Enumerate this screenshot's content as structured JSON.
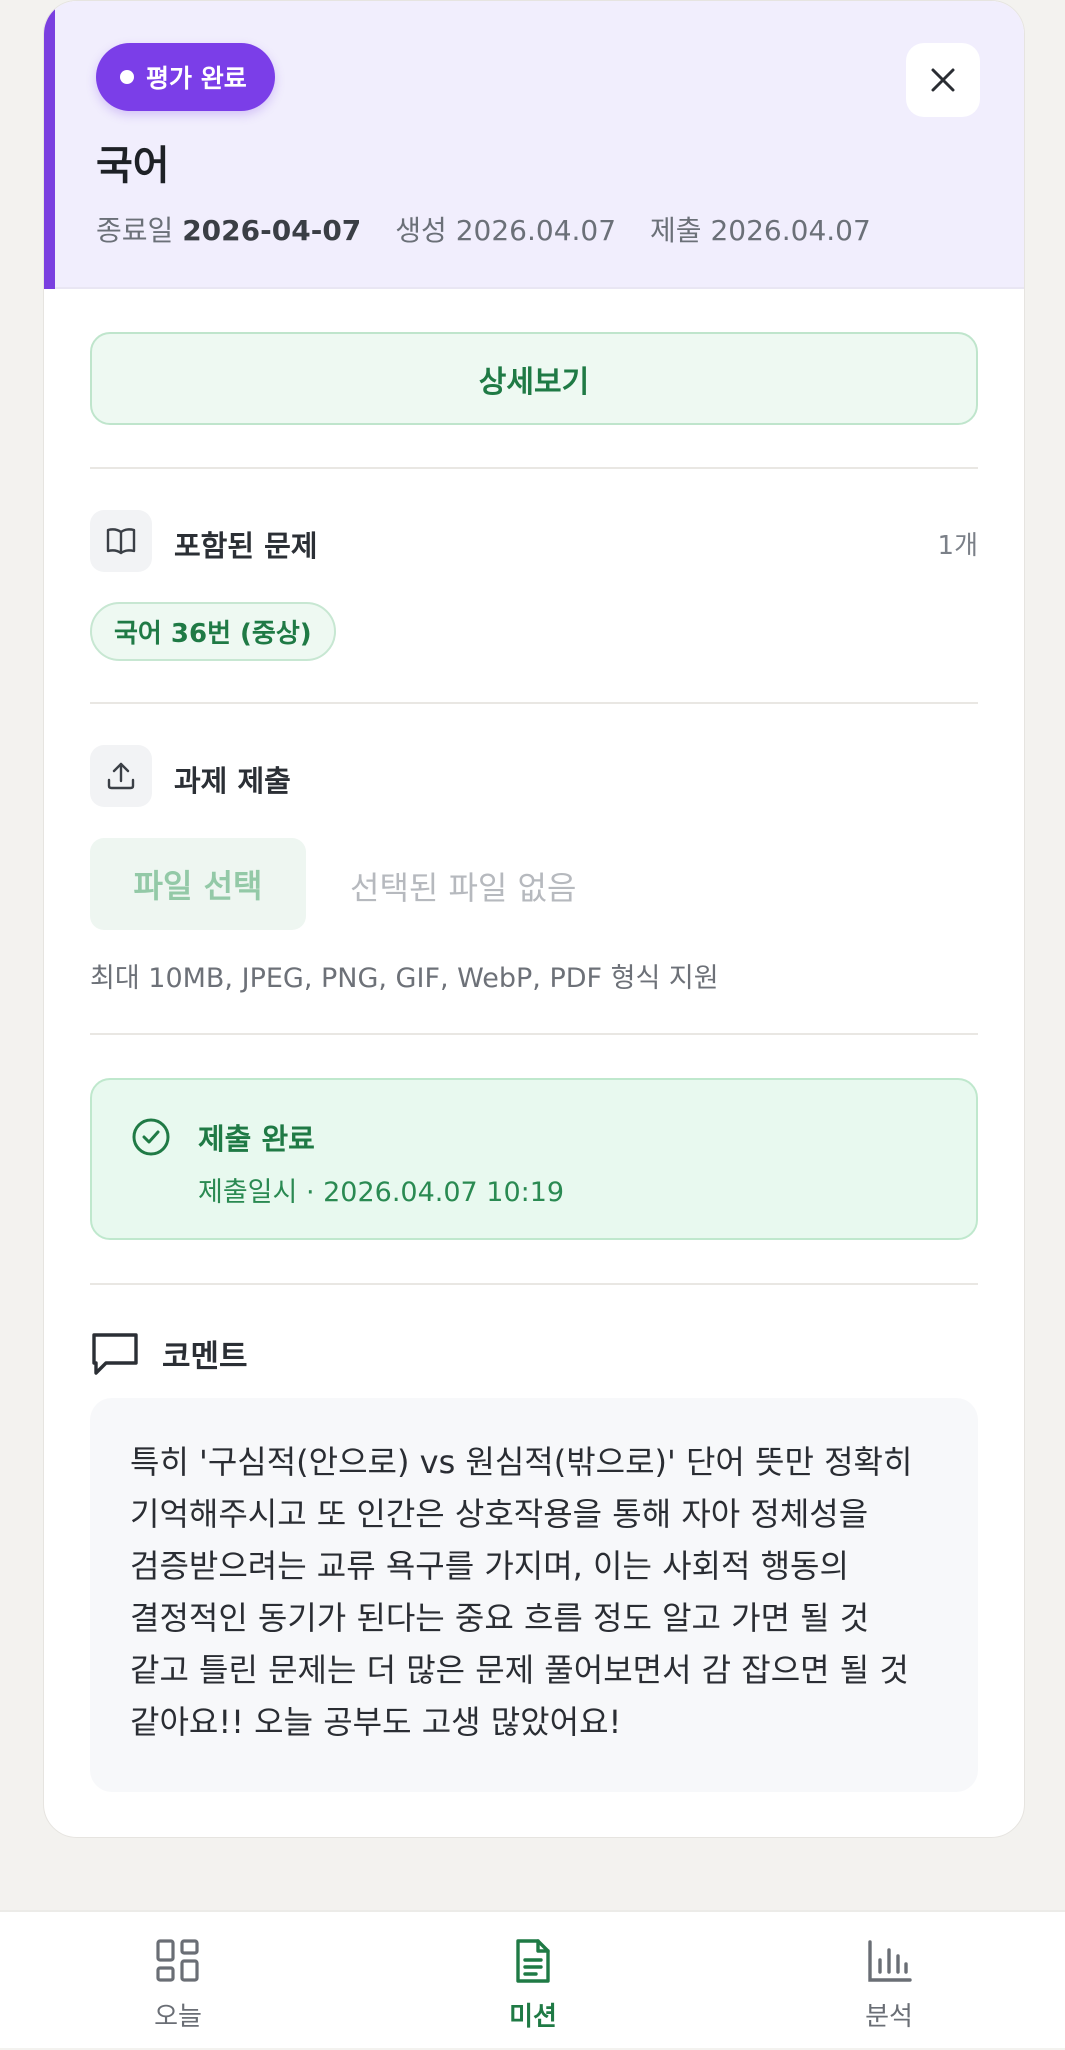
{
  "header": {
    "status_badge": "평가 완료",
    "subject": "국어",
    "due_label": "종료일",
    "due_date": "2026-04-07",
    "created": "생성 2026.04.07",
    "submitted": "제출 2026.04.07",
    "accent_color": "#7b3ee8"
  },
  "detail_button": "상세보기",
  "problems": {
    "title": "포함된 문제",
    "count": "1개",
    "items": [
      "국어 36번 (중상)"
    ],
    "icon": "book-icon"
  },
  "upload": {
    "title": "과제 제출",
    "file_button": "파일 선택",
    "file_status": "선택된 파일 없음",
    "hint": "최대 10MB, JPEG, PNG, GIF, WebP, PDF 형식 지원",
    "icon": "upload-icon"
  },
  "submission": {
    "title": "제출 완료",
    "time": "제출일시 · 2026.04.07 10:19",
    "icon": "check-circle-icon",
    "color": "#1f7a45"
  },
  "comment": {
    "title": "코멘트",
    "text": "특히 '구심적(안으로) vs 원심적(밖으로)' 단어 뜻만 정확히 기억해주시고 또 인간은 상호작용을 통해 자아 정체성을 검증받으려는 교류 욕구를 가지며, 이는 사회적 행동의 결정적인 동기가 된다는 중요 흐름 정도 알고 가면 될 것 같고 틀린 문제는 더 많은 문제 풀어보면서 감 잡으면 될 것 같아요!! 오늘 공부도 고생 많았어요!",
    "icon": "chat-bubble-icon"
  },
  "nav": {
    "today": "오늘",
    "mission": "미션",
    "analysis": "분석",
    "active": "mission"
  }
}
